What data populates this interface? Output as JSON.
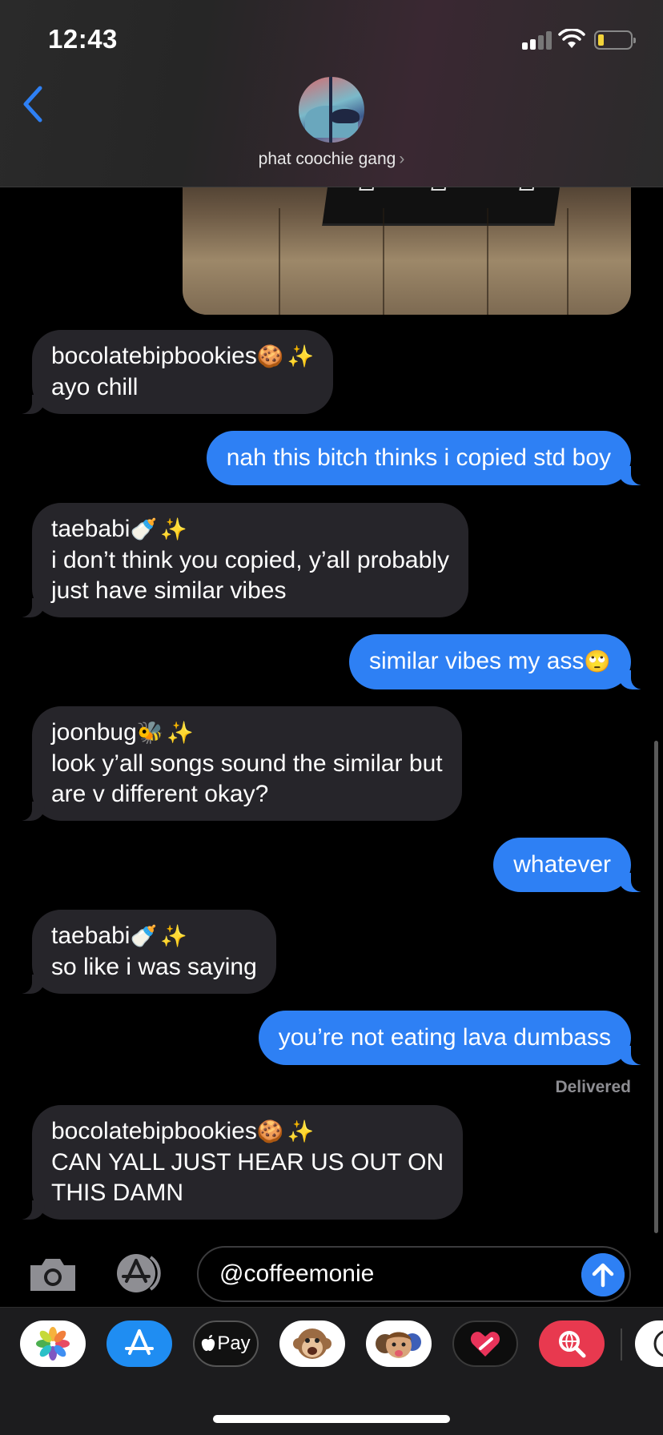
{
  "status_bar": {
    "time": "12:43",
    "battery_color": "#f2d33a"
  },
  "header": {
    "contact_name": "phat coochie gang",
    "chevron": "›",
    "back_icon": "chevron-left-icon"
  },
  "messages": [
    {
      "direction": "in",
      "sender": "bocolatebipbookies",
      "sender_emoji": "🍪",
      "sparkle": "✨",
      "text": "ayo chill"
    },
    {
      "direction": "out",
      "text": "nah this bitch thinks i copied std boy"
    },
    {
      "direction": "in",
      "sender": "taebabi",
      "sender_emoji": "🍼",
      "sparkle": "✨",
      "text_lines": [
        "i don’t think you copied, y’all probably",
        "just have similar vibes"
      ]
    },
    {
      "direction": "out",
      "text": "similar vibes my ass",
      "emoji": "🙄"
    },
    {
      "direction": "in",
      "sender": "joonbug",
      "sender_emoji": "🐝",
      "sparkle": "✨",
      "text_lines": [
        "look y’all songs sound the similar but",
        "are v different okay?"
      ]
    },
    {
      "direction": "out",
      "text": "whatever"
    },
    {
      "direction": "in",
      "sender": "taebabi",
      "sender_emoji": "🍼",
      "sparkle": "✨",
      "text": "so like i was saying"
    },
    {
      "direction": "out",
      "text": "you’re not eating lava dumbass"
    },
    {
      "direction": "in",
      "sender": "bocolatebipbookies",
      "sender_emoji": "🍪",
      "sparkle": "✨",
      "text_lines": [
        "CAN YALL JUST HEAR US OUT ON",
        "THIS DAMN"
      ]
    }
  ],
  "delivered_label": "Delivered",
  "compose": {
    "value": "@coffeemonie",
    "send_icon": "arrow-up-icon"
  },
  "drawer": {
    "apple_pay_label": "Pay",
    "apps": [
      "photos-icon",
      "app-store-icon",
      "apple-pay-icon",
      "animoji-icon",
      "memoji-icon",
      "digital-touch-icon",
      "web-search-icon"
    ]
  },
  "colors": {
    "outgoing": "#2e80f4",
    "incoming": "#26252a",
    "background": "#000000"
  }
}
